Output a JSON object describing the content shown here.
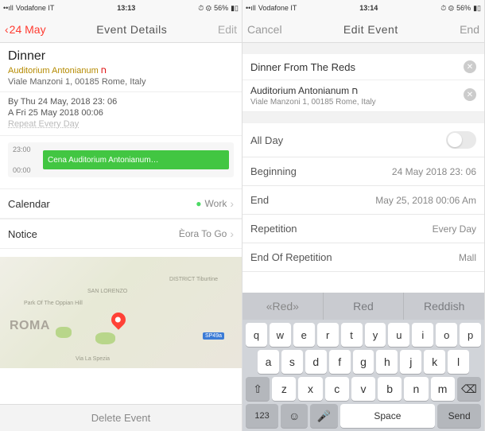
{
  "left": {
    "status": {
      "carrier": "Vodafone IT",
      "time": "13:13",
      "battery": "56%"
    },
    "nav": {
      "back": "24 May",
      "title": "Event Details",
      "edit": "Edit"
    },
    "event": {
      "title": "Dinner",
      "location_name": "Auditorium Antonianum",
      "location_tag": "ח",
      "address": "Viale Manzoni 1, 00185 Rome, Italy"
    },
    "dates": {
      "from": "By Thu 24 May, 2018 23: 06",
      "to": "A Fri 25 May 2018 00:06",
      "repeat": "Repeat Every Day"
    },
    "timeline": {
      "t1": "23:00",
      "t2": "00:00",
      "bar_label": "Cena Auditorium Antonianum…"
    },
    "rows": {
      "calendar_lbl": "Calendar",
      "calendar_val": "Work",
      "notice_lbl": "Notice",
      "notice_val": "Èora To Go"
    },
    "map": {
      "city": "ROMA",
      "road": "SP49a",
      "d1": "SAN LORENZO",
      "d2": "DISTRICT\nTiburtine",
      "d3": "Park Of The\nOppian Hill",
      "d4": "Via La Spezia"
    },
    "delete_label": "Delete Event"
  },
  "right": {
    "status": {
      "carrier": "Vodafone IT",
      "time": "13:14",
      "battery": "56%"
    },
    "nav": {
      "cancel": "Cancel",
      "title": "Edit Event",
      "end": "End"
    },
    "title_input": "Dinner From The Reds",
    "loc": {
      "name": "Auditorium Antonianum ח",
      "addr": "Viale Manzoni 1, 00185 Rome, Italy"
    },
    "rows": {
      "allday": "All Day",
      "beginning_lbl": "Beginning",
      "beginning_val": "24 May 2018 23: 06",
      "end_lbl": "End",
      "end_val": "May 25, 2018 00:06 Am",
      "repetition_lbl": "Repetition",
      "repetition_val": "Every Day",
      "endrep_lbl": "End Of Repetition",
      "endrep_val": "Mall"
    },
    "suggestions": {
      "s1": "«Red»",
      "s2": "Red",
      "s3": "Reddish"
    },
    "keys": {
      "row1": [
        "q",
        "w",
        "e",
        "r",
        "t",
        "y",
        "u",
        "i",
        "o",
        "p"
      ],
      "row2": [
        "a",
        "s",
        "d",
        "f",
        "g",
        "h",
        "j",
        "k",
        "l"
      ],
      "row3": [
        "z",
        "x",
        "c",
        "v",
        "b",
        "n",
        "m"
      ],
      "num": "123",
      "space": "Space",
      "send": "Send"
    }
  }
}
